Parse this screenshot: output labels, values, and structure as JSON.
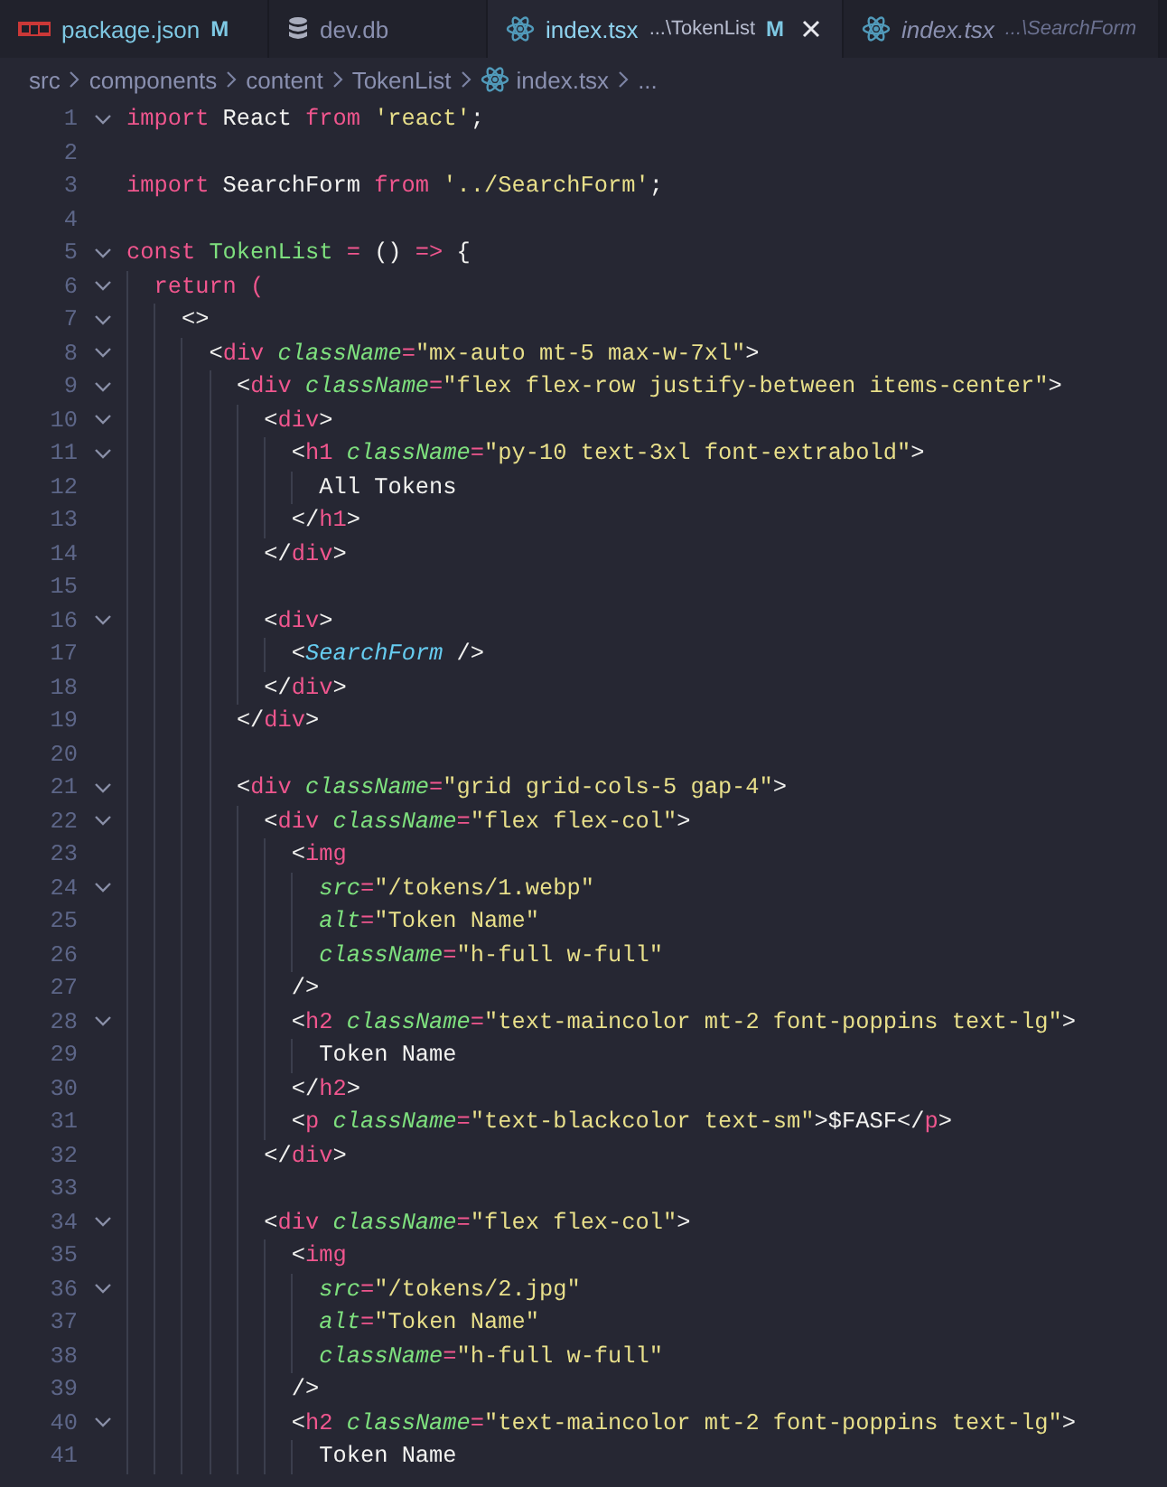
{
  "tabs": [
    {
      "kind": "package",
      "label": "package.json",
      "badge": "M",
      "selected": false,
      "preview": false
    },
    {
      "kind": "database",
      "label": "dev.db",
      "selected": false,
      "preview": false
    },
    {
      "kind": "component",
      "label": "index.tsx",
      "path": "...\\TokenList",
      "badge": "M",
      "selected": true,
      "preview": false
    },
    {
      "kind": "component",
      "label": "index.tsx",
      "path": "...\\SearchForm",
      "selected": false,
      "preview": true
    }
  ],
  "breadcrumbs": [
    {
      "kind": "folder",
      "label": "src"
    },
    {
      "kind": "folder",
      "label": "components"
    },
    {
      "kind": "folder",
      "label": "content"
    },
    {
      "kind": "folder",
      "label": "TokenList"
    },
    {
      "kind": "component",
      "label": "index.tsx"
    },
    {
      "kind": "more",
      "label": "..."
    }
  ],
  "lines": [
    {
      "number": "1",
      "fold": true,
      "tokens": [
        {
          "kind": "keyword",
          "text": "import"
        },
        {
          "kind": "plain",
          "text": " React "
        },
        {
          "kind": "keyword",
          "text": "from"
        },
        {
          "kind": "string",
          "text": " 'react'"
        },
        {
          "kind": "plain",
          "text": ";"
        }
      ]
    },
    {
      "number": "2",
      "fold": false
    },
    {
      "number": "3",
      "fold": false,
      "tokens": [
        {
          "kind": "keyword",
          "text": "import"
        },
        {
          "kind": "plain",
          "text": " SearchForm "
        },
        {
          "kind": "keyword",
          "text": "from"
        },
        {
          "kind": "string",
          "text": " '../SearchForm'"
        },
        {
          "kind": "plain",
          "text": ";"
        }
      ]
    },
    {
      "number": "4",
      "fold": false
    },
    {
      "number": "5",
      "fold": true,
      "tokens": [
        {
          "kind": "keyword",
          "text": "const"
        },
        {
          "kind": "name",
          "text": " TokenList"
        },
        {
          "kind": "op",
          "text": " ="
        },
        {
          "kind": "plain",
          "text": " () "
        },
        {
          "kind": "op",
          "text": "=>"
        },
        {
          "kind": "plain",
          "text": " {"
        }
      ]
    },
    {
      "number": "6",
      "fold": true,
      "tokens": [
        {
          "kind": "keyword",
          "text": "  return"
        },
        {
          "kind": "op",
          "text": " ("
        }
      ]
    },
    {
      "number": "7",
      "fold": true,
      "tokens": [
        {
          "kind": "punct",
          "text": "    <>"
        }
      ]
    },
    {
      "number": "8",
      "fold": true,
      "tokens": [
        {
          "kind": "punct",
          "text": "      <"
        },
        {
          "kind": "tag",
          "text": "div"
        },
        {
          "kind": "attr",
          "text": " className"
        },
        {
          "kind": "op",
          "text": "="
        },
        {
          "kind": "string",
          "text": "\"mx-auto mt-5 max-w-7xl\""
        },
        {
          "kind": "punct",
          "text": ">"
        }
      ]
    },
    {
      "number": "9",
      "fold": true,
      "tokens": [
        {
          "kind": "punct",
          "text": "        <"
        },
        {
          "kind": "tag",
          "text": "div"
        },
        {
          "kind": "attr",
          "text": " className"
        },
        {
          "kind": "op",
          "text": "="
        },
        {
          "kind": "string",
          "text": "\"flex flex-row justify-between items-center\""
        },
        {
          "kind": "punct",
          "text": ">"
        }
      ]
    },
    {
      "number": "10",
      "fold": true,
      "tokens": [
        {
          "kind": "punct",
          "text": "          <"
        },
        {
          "kind": "tag",
          "text": "div"
        },
        {
          "kind": "punct",
          "text": ">"
        }
      ]
    },
    {
      "number": "11",
      "fold": true,
      "tokens": [
        {
          "kind": "punct",
          "text": "            <"
        },
        {
          "kind": "tag",
          "text": "h1"
        },
        {
          "kind": "attr",
          "text": " className"
        },
        {
          "kind": "op",
          "text": "="
        },
        {
          "kind": "string",
          "text": "\"py-10 text-3xl font-extrabold\""
        },
        {
          "kind": "punct",
          "text": ">"
        }
      ]
    },
    {
      "number": "12",
      "fold": false,
      "tokens": [
        {
          "kind": "plain",
          "text": "              All Tokens"
        }
      ]
    },
    {
      "number": "13",
      "fold": false,
      "tokens": [
        {
          "kind": "punct",
          "text": "            </"
        },
        {
          "kind": "tag",
          "text": "h1"
        },
        {
          "kind": "punct",
          "text": ">"
        }
      ]
    },
    {
      "number": "14",
      "fold": false,
      "tokens": [
        {
          "kind": "punct",
          "text": "          </"
        },
        {
          "kind": "tag",
          "text": "div"
        },
        {
          "kind": "punct",
          "text": ">"
        }
      ]
    },
    {
      "number": "15",
      "fold": false
    },
    {
      "number": "16",
      "fold": true,
      "tokens": [
        {
          "kind": "punct",
          "text": "          <"
        },
        {
          "kind": "tag",
          "text": "div"
        },
        {
          "kind": "punct",
          "text": ">"
        }
      ]
    },
    {
      "number": "17",
      "fold": false,
      "tokens": [
        {
          "kind": "punct",
          "text": "            <"
        },
        {
          "kind": "component",
          "text": "SearchForm"
        },
        {
          "kind": "punct",
          "text": " />"
        }
      ]
    },
    {
      "number": "18",
      "fold": false,
      "tokens": [
        {
          "kind": "punct",
          "text": "          </"
        },
        {
          "kind": "tag",
          "text": "div"
        },
        {
          "kind": "punct",
          "text": ">"
        }
      ]
    },
    {
      "number": "19",
      "fold": false,
      "tokens": [
        {
          "kind": "punct",
          "text": "        </"
        },
        {
          "kind": "tag",
          "text": "div"
        },
        {
          "kind": "punct",
          "text": ">"
        }
      ]
    },
    {
      "number": "20",
      "fold": false
    },
    {
      "number": "21",
      "fold": true,
      "tokens": [
        {
          "kind": "punct",
          "text": "        <"
        },
        {
          "kind": "tag",
          "text": "div"
        },
        {
          "kind": "attr",
          "text": " className"
        },
        {
          "kind": "op",
          "text": "="
        },
        {
          "kind": "string",
          "text": "\"grid grid-cols-5 gap-4\""
        },
        {
          "kind": "punct",
          "text": ">"
        }
      ]
    },
    {
      "number": "22",
      "fold": true,
      "tokens": [
        {
          "kind": "punct",
          "text": "          <"
        },
        {
          "kind": "tag",
          "text": "div"
        },
        {
          "kind": "attr",
          "text": " className"
        },
        {
          "kind": "op",
          "text": "="
        },
        {
          "kind": "string",
          "text": "\"flex flex-col\""
        },
        {
          "kind": "punct",
          "text": ">"
        }
      ]
    },
    {
      "number": "23",
      "fold": false,
      "tokens": [
        {
          "kind": "punct",
          "text": "            <"
        },
        {
          "kind": "tag",
          "text": "img"
        }
      ]
    },
    {
      "number": "24",
      "fold": true,
      "tokens": [
        {
          "kind": "attr",
          "text": "              src"
        },
        {
          "kind": "op",
          "text": "="
        },
        {
          "kind": "string",
          "text": "\"/tokens/1.webp\""
        }
      ]
    },
    {
      "number": "25",
      "fold": false,
      "tokens": [
        {
          "kind": "attr",
          "text": "              alt"
        },
        {
          "kind": "op",
          "text": "="
        },
        {
          "kind": "string",
          "text": "\"Token Name\""
        }
      ]
    },
    {
      "number": "26",
      "fold": false,
      "tokens": [
        {
          "kind": "attr",
          "text": "              className"
        },
        {
          "kind": "op",
          "text": "="
        },
        {
          "kind": "string",
          "text": "\"h-full w-full\""
        }
      ]
    },
    {
      "number": "27",
      "fold": false,
      "tokens": [
        {
          "kind": "punct",
          "text": "            />"
        }
      ]
    },
    {
      "number": "28",
      "fold": true,
      "tokens": [
        {
          "kind": "punct",
          "text": "            <"
        },
        {
          "kind": "tag",
          "text": "h2"
        },
        {
          "kind": "attr",
          "text": " className"
        },
        {
          "kind": "op",
          "text": "="
        },
        {
          "kind": "string",
          "text": "\"text-maincolor mt-2 font-poppins text-lg\""
        },
        {
          "kind": "punct",
          "text": ">"
        }
      ]
    },
    {
      "number": "29",
      "fold": false,
      "tokens": [
        {
          "kind": "plain",
          "text": "              Token Name"
        }
      ]
    },
    {
      "number": "30",
      "fold": false,
      "tokens": [
        {
          "kind": "punct",
          "text": "            </"
        },
        {
          "kind": "tag",
          "text": "h2"
        },
        {
          "kind": "punct",
          "text": ">"
        }
      ]
    },
    {
      "number": "31",
      "fold": false,
      "tokens": [
        {
          "kind": "punct",
          "text": "            <"
        },
        {
          "kind": "tag",
          "text": "p"
        },
        {
          "kind": "attr",
          "text": " className"
        },
        {
          "kind": "op",
          "text": "="
        },
        {
          "kind": "string",
          "text": "\"text-blackcolor text-sm\""
        },
        {
          "kind": "punct",
          "text": ">"
        },
        {
          "kind": "plain",
          "text": "$FASF"
        },
        {
          "kind": "punct",
          "text": "</"
        },
        {
          "kind": "tag",
          "text": "p"
        },
        {
          "kind": "punct",
          "text": ">"
        }
      ]
    },
    {
      "number": "32",
      "fold": false,
      "tokens": [
        {
          "kind": "punct",
          "text": "          </"
        },
        {
          "kind": "tag",
          "text": "div"
        },
        {
          "kind": "punct",
          "text": ">"
        }
      ]
    },
    {
      "number": "33",
      "fold": false
    },
    {
      "number": "34",
      "fold": true,
      "tokens": [
        {
          "kind": "punct",
          "text": "          <"
        },
        {
          "kind": "tag",
          "text": "div"
        },
        {
          "kind": "attr",
          "text": " className"
        },
        {
          "kind": "op",
          "text": "="
        },
        {
          "kind": "string",
          "text": "\"flex flex-col\""
        },
        {
          "kind": "punct",
          "text": ">"
        }
      ]
    },
    {
      "number": "35",
      "fold": false,
      "tokens": [
        {
          "kind": "punct",
          "text": "            <"
        },
        {
          "kind": "tag",
          "text": "img"
        }
      ]
    },
    {
      "number": "36",
      "fold": true,
      "tokens": [
        {
          "kind": "attr",
          "text": "              src"
        },
        {
          "kind": "op",
          "text": "="
        },
        {
          "kind": "string",
          "text": "\"/tokens/2.jpg\""
        }
      ]
    },
    {
      "number": "37",
      "fold": false,
      "tokens": [
        {
          "kind": "attr",
          "text": "              alt"
        },
        {
          "kind": "op",
          "text": "="
        },
        {
          "kind": "string",
          "text": "\"Token Name\""
        }
      ]
    },
    {
      "number": "38",
      "fold": false,
      "tokens": [
        {
          "kind": "attr",
          "text": "              className"
        },
        {
          "kind": "op",
          "text": "="
        },
        {
          "kind": "string",
          "text": "\"h-full w-full\""
        }
      ]
    },
    {
      "number": "39",
      "fold": false,
      "tokens": [
        {
          "kind": "punct",
          "text": "            />"
        }
      ]
    },
    {
      "number": "40",
      "fold": true,
      "tokens": [
        {
          "kind": "punct",
          "text": "            <"
        },
        {
          "kind": "tag",
          "text": "h2"
        },
        {
          "kind": "attr",
          "text": " className"
        },
        {
          "kind": "op",
          "text": "="
        },
        {
          "kind": "string",
          "text": "\"text-maincolor mt-2 font-poppins text-lg\""
        },
        {
          "kind": "punct",
          "text": ">"
        }
      ]
    },
    {
      "number": "41",
      "fold": false,
      "tokens": [
        {
          "kind": "plain",
          "text": "              Token Name"
        }
      ]
    }
  ]
}
